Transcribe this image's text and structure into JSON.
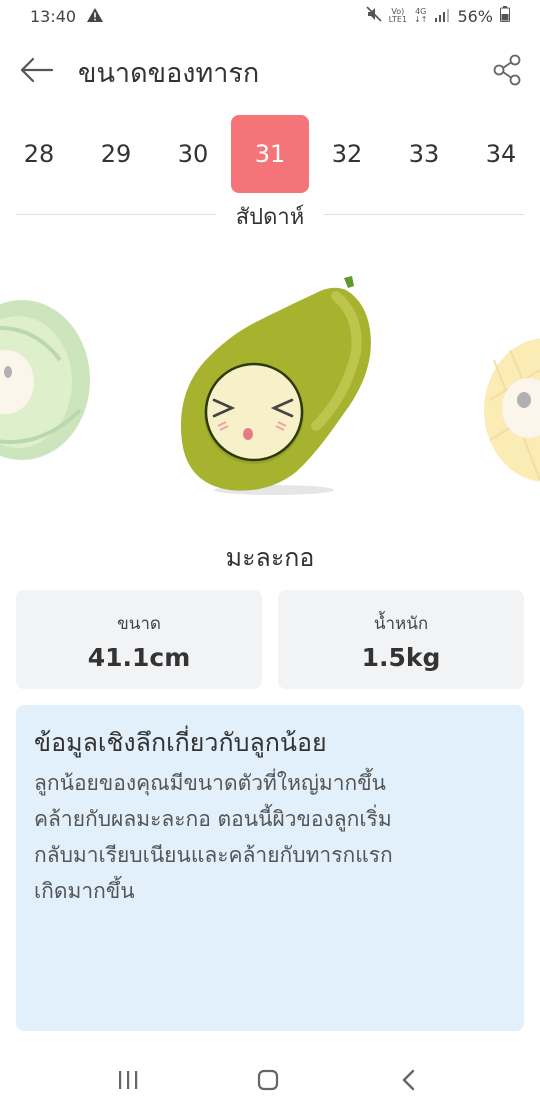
{
  "status_bar": {
    "time": "13:40",
    "network_top": "Vo)",
    "network_bottom": "LTE1",
    "data_top": "4G",
    "data_bottom": "↓↑",
    "battery": "56%"
  },
  "header": {
    "title": "ขนาดของทารก"
  },
  "week_selector": {
    "weeks": [
      "28",
      "29",
      "30",
      "31",
      "32",
      "33",
      "34"
    ],
    "selected": "31",
    "label": "สัปดาห์"
  },
  "illustration": {
    "fruit_name": "มะละกอ",
    "colors": {
      "fruit": "#a7b22f",
      "face": "#f6f1c9",
      "selected_week": "#f47479"
    }
  },
  "stats": {
    "size_label": "ขนาด",
    "size_value": "41.1cm",
    "weight_label": "น้ำหนัก",
    "weight_value": "1.5kg"
  },
  "insight": {
    "title": "ข้อมูลเชิงลึกเกี่ยวกับลูกน้อย",
    "line1": "ลูกน้อยของคุณมีขนาดตัวที่ใหญ่มากขึ้น",
    "line2": "คล้ายกับผลมะละกอ ตอนนี้ผิวของลูกเริ่ม",
    "line3": "กลับมาเรียบเนียนและคล้ายกับทารกแรก",
    "line4": "เกิดมากขึ้น"
  },
  "icons": {
    "status": [
      "warning-icon",
      "mute-icon",
      "signal-icon",
      "battery-icon"
    ],
    "header": [
      "back-arrow-icon",
      "share-icon"
    ],
    "nav": [
      "recent-apps-icon",
      "home-icon",
      "back-icon"
    ]
  }
}
